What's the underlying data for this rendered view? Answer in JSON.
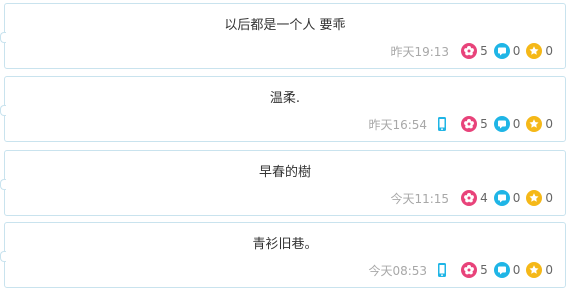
{
  "posts": [
    {
      "text": "以后都是一个人 要乖",
      "time": "昨天19:13",
      "from_mobile": false,
      "likes": "5",
      "comments": "0",
      "favorites": "0"
    },
    {
      "text": "温柔.",
      "time": "昨天16:54",
      "from_mobile": true,
      "likes": "5",
      "comments": "0",
      "favorites": "0"
    },
    {
      "text": "早春的樹",
      "time": "今天11:15",
      "from_mobile": false,
      "likes": "4",
      "comments": "0",
      "favorites": "0"
    },
    {
      "text": "青衫旧巷。",
      "time": "今天08:53",
      "from_mobile": true,
      "likes": "5",
      "comments": "0",
      "favorites": "0"
    }
  ],
  "icons": {
    "like": "flower-icon",
    "comment": "comment-bubble-icon",
    "favorite": "star-icon",
    "mobile": "mobile-phone-icon"
  },
  "colors": {
    "like": "#e8437a",
    "comment": "#1fb5e6",
    "favorite": "#f5b818",
    "border": "#c9e3ee"
  }
}
